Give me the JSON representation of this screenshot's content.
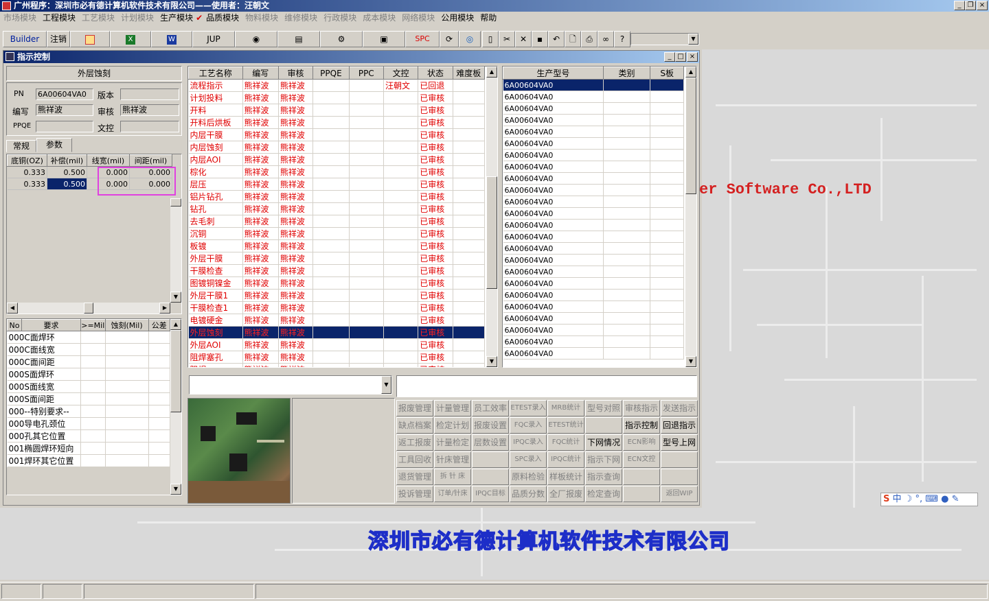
{
  "window": {
    "title": "广州程序：深圳市必有德计算机软件技术有限公司——使用者：汪朝文"
  },
  "menu": [
    {
      "label": "市场模块",
      "enabled": false
    },
    {
      "label": "工程模块",
      "enabled": true
    },
    {
      "label": "工艺模块",
      "enabled": false
    },
    {
      "label": "计划模块",
      "enabled": false
    },
    {
      "label": "生产模块",
      "enabled": true
    },
    {
      "label": "品质模块",
      "enabled": true
    },
    {
      "label": "物料模块",
      "enabled": false
    },
    {
      "label": "维修模块",
      "enabled": false
    },
    {
      "label": "行政模块",
      "enabled": false
    },
    {
      "label": "成本模块",
      "enabled": false
    },
    {
      "label": "网络模块",
      "enabled": false
    },
    {
      "label": "公用模块",
      "enabled": true
    },
    {
      "label": "帮助",
      "enabled": true
    }
  ],
  "toolbar": {
    "builder": "Builder",
    "logout": "注销",
    "jup": "JUP",
    "spc": "SPC"
  },
  "desktop": {
    "company": "深圳市必有德计算机软件技术有限公司",
    "software": "er Software Co.,LTD"
  },
  "child": {
    "title": "指示控制"
  },
  "left": {
    "heading": "外层蚀刻",
    "pn_label": "PN",
    "pn_value": "6A00604VA0",
    "version_label": "版本",
    "version_value": "",
    "author_label": "编写",
    "author_value": "熊祥波",
    "review_label": "审核",
    "review_value": "熊祥波",
    "ppqe_label": "PPQE",
    "ppqe_value": "",
    "doc_label": "文控",
    "doc_value": "",
    "tabs": [
      "常规",
      "参数"
    ],
    "param_headers": [
      "底铜(OZ)",
      "补偿(mil)",
      "线宽(mil)",
      "间距(mil)"
    ],
    "param_rows": [
      [
        "0.333",
        "0.500",
        "0.000",
        "0.000"
      ],
      [
        "0.333",
        "0.500",
        "0.000",
        "0.000"
      ]
    ],
    "req_headers": [
      "No",
      "要求",
      ">=Mil",
      "蚀刻(Mil)",
      "公差"
    ],
    "req_rows": [
      [
        "000",
        "C面焊环"
      ],
      [
        "000",
        "C面线宽"
      ],
      [
        "000",
        "C面间距"
      ],
      [
        "000",
        "S面焊环"
      ],
      [
        "000",
        "S面线宽"
      ],
      [
        "000",
        "S面间距"
      ],
      [
        "000",
        "--特别要求--"
      ],
      [
        "000",
        "导电孔颈位"
      ],
      [
        "000",
        "孔其它位置"
      ],
      [
        "001",
        "椭圆焊环短向"
      ],
      [
        "001",
        "焊环其它位置"
      ]
    ]
  },
  "process": {
    "headers": [
      "工艺名称",
      "编写",
      "审核",
      "PPQE",
      "PPC",
      "文控",
      "状态",
      "难度板"
    ],
    "rows": [
      [
        "流程指示",
        "熊祥波",
        "熊祥波",
        "",
        "",
        "汪朝文",
        "已回退",
        ""
      ],
      [
        "计划投料",
        "熊祥波",
        "熊祥波",
        "",
        "",
        "",
        "已审核",
        ""
      ],
      [
        "开料",
        "熊祥波",
        "熊祥波",
        "",
        "",
        "",
        "已审核",
        ""
      ],
      [
        "开料后烘板",
        "熊祥波",
        "熊祥波",
        "",
        "",
        "",
        "已审核",
        ""
      ],
      [
        "内层干膜",
        "熊祥波",
        "熊祥波",
        "",
        "",
        "",
        "已审核",
        ""
      ],
      [
        "内层蚀刻",
        "熊祥波",
        "熊祥波",
        "",
        "",
        "",
        "已审核",
        ""
      ],
      [
        "内层AOI",
        "熊祥波",
        "熊祥波",
        "",
        "",
        "",
        "已审核",
        ""
      ],
      [
        "棕化",
        "熊祥波",
        "熊祥波",
        "",
        "",
        "",
        "已审核",
        ""
      ],
      [
        "层压",
        "熊祥波",
        "熊祥波",
        "",
        "",
        "",
        "已审核",
        ""
      ],
      [
        "铝片钻孔",
        "熊祥波",
        "熊祥波",
        "",
        "",
        "",
        "已审核",
        ""
      ],
      [
        "钻孔",
        "熊祥波",
        "熊祥波",
        "",
        "",
        "",
        "已审核",
        ""
      ],
      [
        "去毛刺",
        "熊祥波",
        "熊祥波",
        "",
        "",
        "",
        "已审核",
        ""
      ],
      [
        "沉铜",
        "熊祥波",
        "熊祥波",
        "",
        "",
        "",
        "已审核",
        ""
      ],
      [
        "板镀",
        "熊祥波",
        "熊祥波",
        "",
        "",
        "",
        "已审核",
        ""
      ],
      [
        "外层干膜",
        "熊祥波",
        "熊祥波",
        "",
        "",
        "",
        "已审核",
        ""
      ],
      [
        "干膜检查",
        "熊祥波",
        "熊祥波",
        "",
        "",
        "",
        "已审核",
        ""
      ],
      [
        "图镀铜镍金",
        "熊祥波",
        "熊祥波",
        "",
        "",
        "",
        "已审核",
        ""
      ],
      [
        "外层干膜1",
        "熊祥波",
        "熊祥波",
        "",
        "",
        "",
        "已审核",
        ""
      ],
      [
        "干膜检查1",
        "熊祥波",
        "熊祥波",
        "",
        "",
        "",
        "已审核",
        ""
      ],
      [
        "电镀硬金",
        "熊祥波",
        "熊祥波",
        "",
        "",
        "",
        "已审核",
        ""
      ],
      [
        "外层蚀刻",
        "熊祥波",
        "熊祥波",
        "",
        "",
        "",
        "已审核",
        ""
      ],
      [
        "外层AOI",
        "熊祥波",
        "熊祥波",
        "",
        "",
        "",
        "已审核",
        ""
      ],
      [
        "阻焊塞孔",
        "熊祥波",
        "熊祥波",
        "",
        "",
        "",
        "已审核",
        ""
      ],
      [
        "阻焊",
        "熊祥波",
        "熊祥波",
        "",
        "",
        "",
        "已审核",
        ""
      ]
    ],
    "selected_index": 20
  },
  "models": {
    "headers": [
      "生产型号",
      "类别",
      "S板"
    ],
    "rows": [
      "6A00604VA0",
      "6A00604VA0",
      "6A00604VA0",
      "6A00604VA0",
      "6A00604VA0",
      "6A00604VA0",
      "6A00604VA0",
      "6A00604VA0",
      "6A00604VA0",
      "6A00604VA0",
      "6A00604VA0",
      "6A00604VA0",
      "6A00604VA0",
      "6A00604VA0",
      "6A00604VA0",
      "6A00604VA0",
      "6A00604VA0",
      "6A00604VA0",
      "6A00604VA0",
      "6A00604VA0",
      "6A00604VA0",
      "6A00604VA0",
      "6A00604VA0",
      "6A00604VA0"
    ]
  },
  "buttons": [
    [
      {
        "l": "报废管理",
        "e": false
      },
      {
        "l": "计量管理",
        "e": false
      },
      {
        "l": "员工效率",
        "e": false
      },
      {
        "l": "ETEST录入",
        "e": false
      },
      {
        "l": "MRB统计",
        "e": false
      },
      {
        "l": "型号对照",
        "e": false
      },
      {
        "l": "审核指示",
        "e": false
      },
      {
        "l": "发送指示",
        "e": false
      }
    ],
    [
      {
        "l": "缺点档案",
        "e": false
      },
      {
        "l": "检定计划",
        "e": false
      },
      {
        "l": "报废设置",
        "e": false
      },
      {
        "l": "FQC录入",
        "e": false
      },
      {
        "l": "ETEST统计",
        "e": false
      },
      {
        "l": "",
        "e": false
      },
      {
        "l": "指示控制",
        "e": true
      },
      {
        "l": "回退指示",
        "e": true
      }
    ],
    [
      {
        "l": "返工报废",
        "e": false
      },
      {
        "l": "计量检定",
        "e": false
      },
      {
        "l": "层数设置",
        "e": false
      },
      {
        "l": "IPQC录入",
        "e": false
      },
      {
        "l": "FQC统计",
        "e": false
      },
      {
        "l": "下网情况",
        "e": true
      },
      {
        "l": "ECN影响",
        "e": false
      },
      {
        "l": "型号上网",
        "e": true
      }
    ],
    [
      {
        "l": "工具回收",
        "e": false
      },
      {
        "l": "针床管理",
        "e": false
      },
      {
        "l": "",
        "e": false
      },
      {
        "l": "SPC录入",
        "e": false
      },
      {
        "l": "IPQC统计",
        "e": false
      },
      {
        "l": "指示下网",
        "e": false
      },
      {
        "l": "ECN文控",
        "e": false
      },
      {
        "l": "",
        "e": false
      }
    ],
    [
      {
        "l": "退货管理",
        "e": false
      },
      {
        "l": "拆 针 床",
        "e": false
      },
      {
        "l": "",
        "e": false
      },
      {
        "l": "原料检验",
        "e": false
      },
      {
        "l": "样板统计",
        "e": false
      },
      {
        "l": "指示查询",
        "e": false
      },
      {
        "l": "",
        "e": false
      },
      {
        "l": "",
        "e": false
      }
    ],
    [
      {
        "l": "投诉管理",
        "e": false
      },
      {
        "l": "订单/针床",
        "e": false
      },
      {
        "l": "IPQC目标",
        "e": false
      },
      {
        "l": "品质分数",
        "e": false
      },
      {
        "l": "全厂报废",
        "e": false
      },
      {
        "l": "检定查询",
        "e": false
      },
      {
        "l": "",
        "e": false
      },
      {
        "l": "返回WIP",
        "e": false
      }
    ]
  ],
  "ime": {
    "text": "中"
  }
}
